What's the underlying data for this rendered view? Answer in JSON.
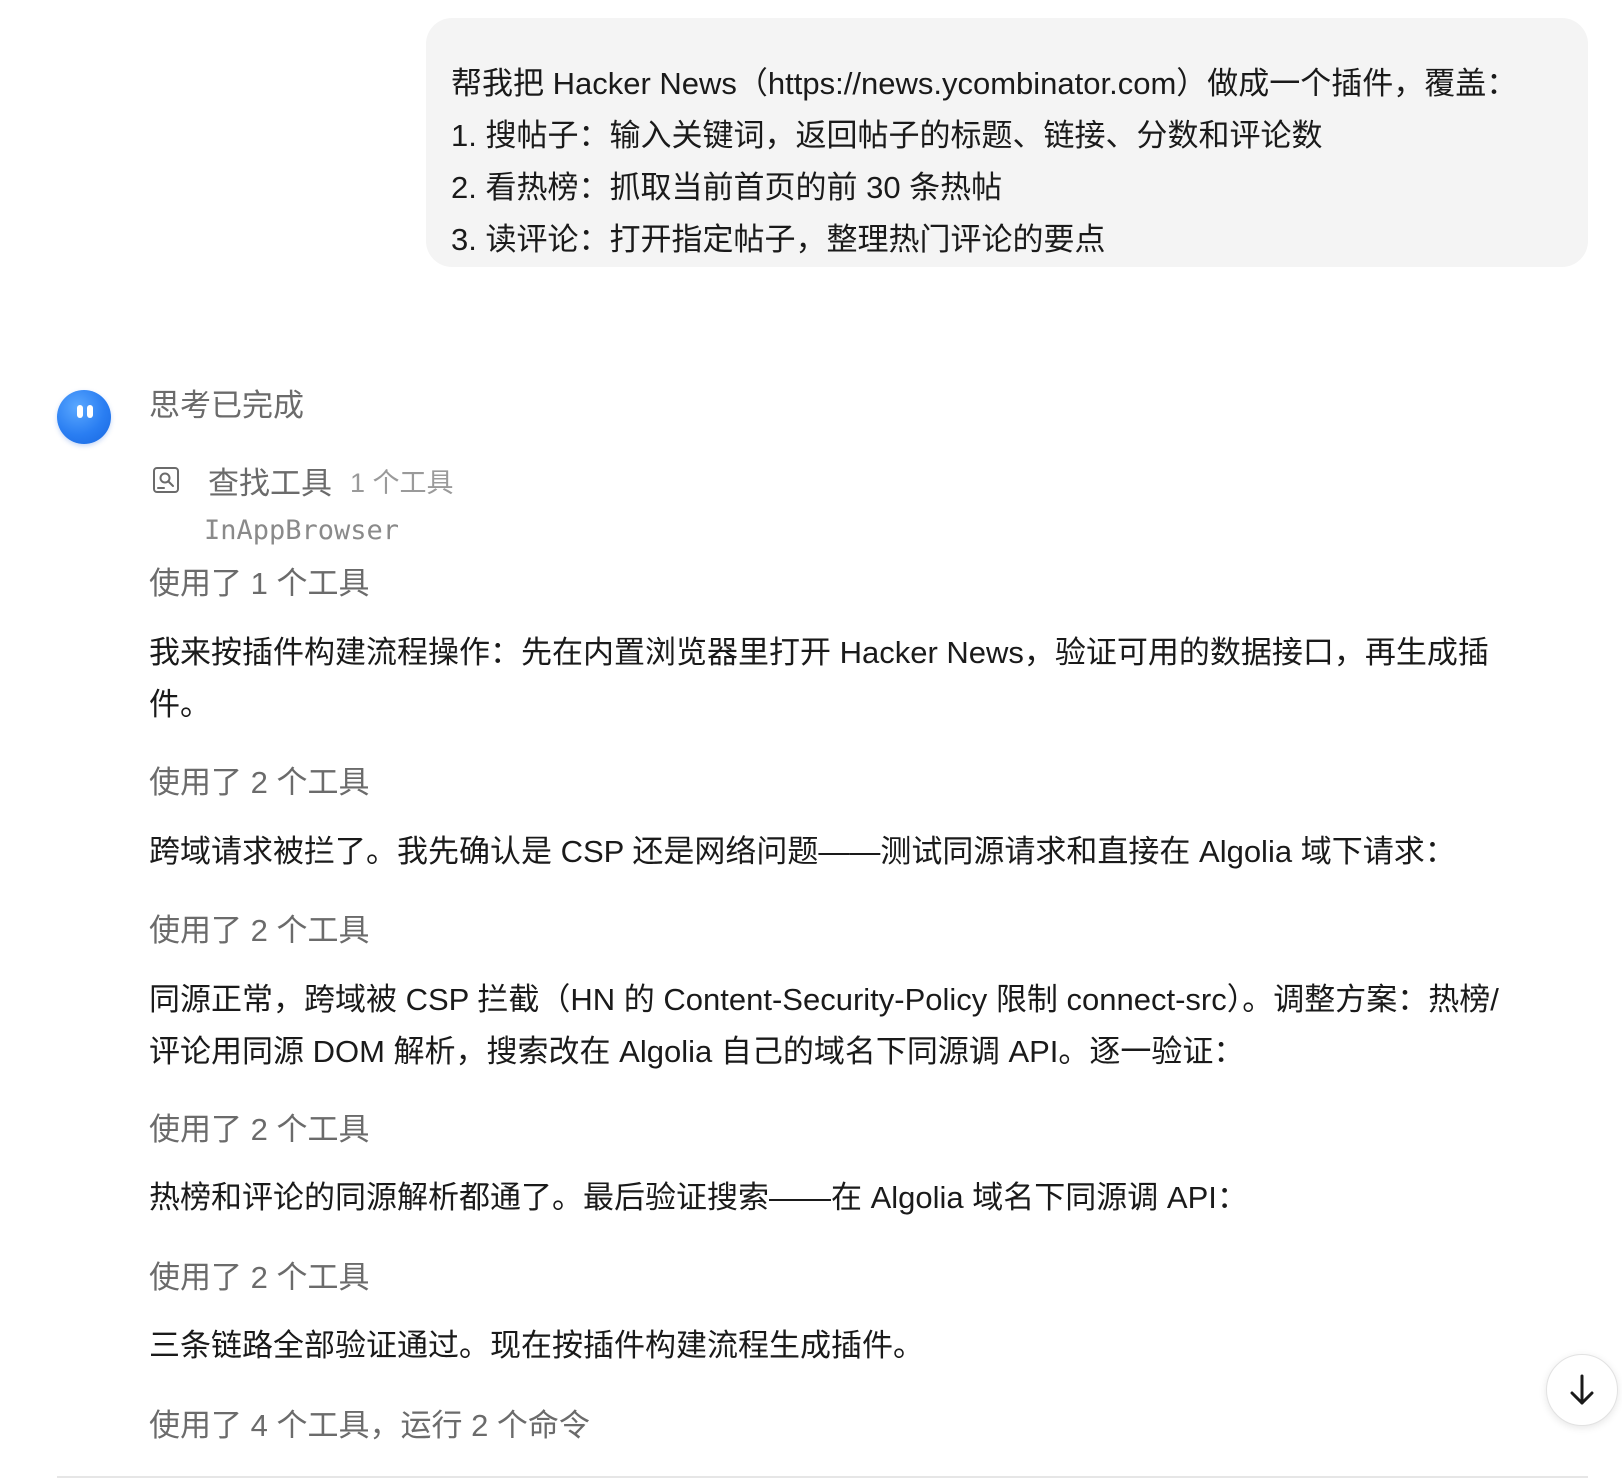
{
  "user_message": {
    "lines": [
      "帮我把 Hacker News（https://news.ycombinator.com）做成一个插件，覆盖：",
      "1. 搜帖子：输入关键词，返回帖子的标题、链接、分数和评论数",
      "2. 看热榜：抓取当前首页的前 30 条热帖",
      "3. 读评论：打开指定帖子，整理热门评论的要点"
    ]
  },
  "assistant": {
    "avatar_color": "#2a7ef2",
    "thinking_status": "思考已完成",
    "tool_search": {
      "icon": "image-search-icon",
      "label": "查找工具",
      "count": "1 个工具",
      "tool_name": "InAppBrowser"
    },
    "steps": [
      {
        "used_tools": "使用了 1 个工具",
        "text_lines": [
          "我来按插件构建流程操作：先在内置浏览器里打开 Hacker News，验证可用的数据接口，再生成插",
          "件。"
        ]
      },
      {
        "used_tools": "使用了 2 个工具",
        "text_lines": [
          "跨域请求被拦了。我先确认是 CSP 还是网络问题——测试同源请求和直接在 Algolia 域下请求："
        ]
      },
      {
        "used_tools": "使用了 2 个工具",
        "text_lines": [
          "同源正常，跨域被 CSP 拦截（HN 的 Content-Security-Policy 限制 connect-src）。调整方案：热榜/",
          "评论用同源 DOM 解析，搜索改在 Algolia 自己的域名下同源调 API。逐一验证："
        ]
      },
      {
        "used_tools": "使用了 2 个工具",
        "text_lines": [
          "热榜和评论的同源解析都通了。最后验证搜索——在 Algolia 域名下同源调 API："
        ]
      },
      {
        "used_tools": "使用了 2 个工具",
        "text_lines": [
          "三条链路全部验证通过。现在按插件构建流程生成插件。"
        ]
      }
    ],
    "final_used_tools": "使用了 4 个工具，运行 2 个命令"
  },
  "scroll_button": {
    "icon": "arrow-down-icon"
  }
}
